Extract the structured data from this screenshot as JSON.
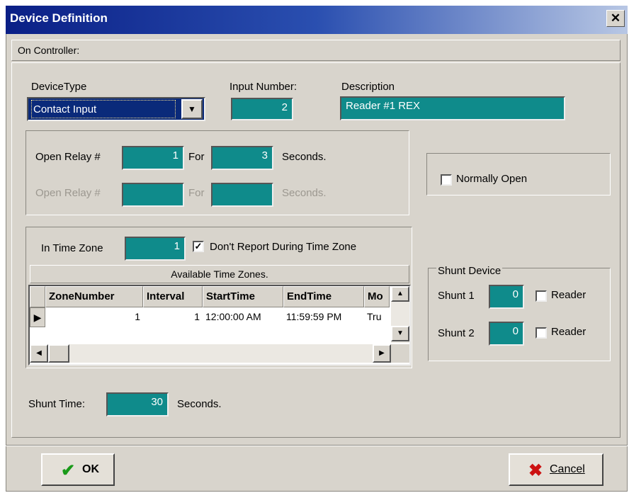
{
  "window": {
    "title": "Device Definition",
    "close_label": "✕"
  },
  "section_title": "On Controller:",
  "device_type": {
    "label": "DeviceType",
    "value": "Contact Input"
  },
  "input_number": {
    "label": "Input Number:",
    "value": "2"
  },
  "description": {
    "label": "Description",
    "value": "Reader #1 REX"
  },
  "relay1": {
    "label": "Open Relay #",
    "value": "1",
    "for_label": "For",
    "duration": "3",
    "seconds_label": "Seconds."
  },
  "relay2": {
    "label": "Open Relay #",
    "value": "",
    "for_label": "For",
    "duration": "",
    "seconds_label": "Seconds."
  },
  "normally_open": {
    "label": "Normally Open",
    "checked": false
  },
  "time_zone": {
    "label": "In Time Zone",
    "value": "1",
    "dont_report_label": "Don't Report During Time Zone",
    "dont_report_checked": true,
    "available_label": "Available Time Zones.",
    "columns": [
      "ZoneNumber",
      "Interval",
      "StartTime",
      "EndTime",
      "Mo"
    ],
    "rows": [
      [
        "1",
        "1",
        "12:00:00 AM",
        "11:59:59 PM",
        "Tru"
      ]
    ]
  },
  "shunt_device": {
    "title": "Shunt Device",
    "shunt1": {
      "label": "Shunt 1",
      "value": "0",
      "reader_label": "Reader",
      "reader_checked": false
    },
    "shunt2": {
      "label": "Shunt 2",
      "value": "0",
      "reader_label": "Reader",
      "reader_checked": false
    }
  },
  "shunt_time": {
    "label": "Shunt Time:",
    "value": "30",
    "seconds_label": "Seconds."
  },
  "buttons": {
    "ok": "OK",
    "cancel": "Cancel"
  },
  "colors": {
    "field_bg": "#0f8b8b",
    "title_bar": "#0a1f86",
    "dialog_bg": "#d8d4cc",
    "ok_check": "#1a9a1a",
    "cancel_x": "#cc1111"
  }
}
